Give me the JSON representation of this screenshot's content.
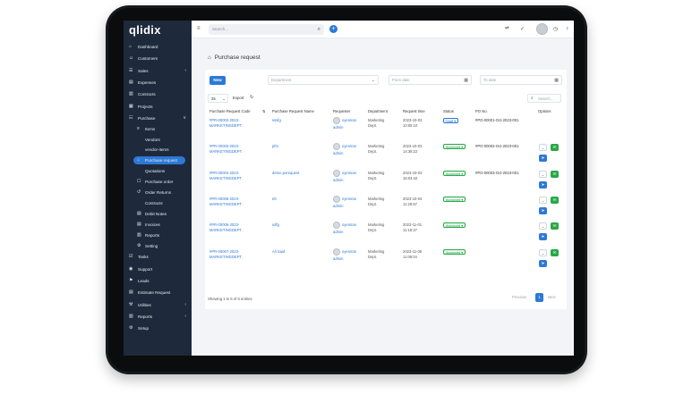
{
  "app": {
    "logo": "qlidix"
  },
  "sidebar": {
    "items": [
      {
        "label": "Dashboard",
        "icon": "⌂",
        "chev": ""
      },
      {
        "label": "Customers",
        "icon": "☺",
        "chev": ""
      },
      {
        "label": "Sales",
        "icon": "☰",
        "chev": "‹"
      },
      {
        "label": "Expenses",
        "icon": "▤",
        "chev": ""
      },
      {
        "label": "Contracts",
        "icon": "▥",
        "chev": ""
      },
      {
        "label": "Projects",
        "icon": "▦",
        "chev": ""
      },
      {
        "label": "Purchase",
        "icon": "☷",
        "chev": "∨"
      }
    ],
    "purchase_sub": [
      {
        "label": "Items",
        "icon": "≡"
      },
      {
        "label": "Vendors",
        "icon": ""
      },
      {
        "label": "vendor-items",
        "icon": ""
      },
      {
        "label": "Purchase request",
        "icon": "⌂"
      },
      {
        "label": "Quotations",
        "icon": ""
      },
      {
        "label": "Purchase order",
        "icon": "☐"
      },
      {
        "label": "Order Returns",
        "icon": "↺"
      },
      {
        "label": "Contracts",
        "icon": ""
      },
      {
        "label": "Debit Notes",
        "icon": "▤"
      },
      {
        "label": "Invoices",
        "icon": "▤"
      },
      {
        "label": "Reports",
        "icon": "▥"
      },
      {
        "label": "Setting",
        "icon": "⚙"
      }
    ],
    "bottom_items": [
      {
        "label": "Tasks",
        "icon": "☑",
        "chev": ""
      },
      {
        "label": "Support",
        "icon": "◉",
        "chev": ""
      },
      {
        "label": "Leads",
        "icon": "⚑",
        "chev": ""
      },
      {
        "label": "Estimate Request",
        "icon": "▤",
        "chev": ""
      },
      {
        "label": "Utilities",
        "icon": "⚒",
        "chev": "‹"
      },
      {
        "label": "Reports",
        "icon": "▥",
        "chev": "‹"
      },
      {
        "label": "Setup",
        "icon": "⚙",
        "chev": ""
      }
    ]
  },
  "topbar": {
    "search_placeholder": "Search...",
    "menu_icon": "≡",
    "search_icon": "⌕",
    "plus": "+",
    "share_icon": "⮂",
    "check_icon": "✓",
    "clock_icon": "◷",
    "bell_icon": "♪"
  },
  "page": {
    "title_icon": "⌂",
    "title": "Purchase request",
    "new_label": "New",
    "department_placeholder": "Department",
    "from_date_placeholder": "From date",
    "to_date_placeholder": "To date",
    "per_page": "25",
    "export_label": "Export",
    "refresh_icon": "↻",
    "search_placeholder": "Search...",
    "calendar_icon": "▦",
    "dropdown_icon": "⌄"
  },
  "table": {
    "headers": [
      "Purchase Request Code",
      "Purchase Request Name",
      "Requester",
      "Department",
      "Request time",
      "Status",
      "PO No.",
      "Options"
    ],
    "rows": [
      {
        "code1": "#PR-00002-2023-",
        "code2": "MARKETINGDEPT.",
        "name": "sssfg",
        "requester_name": "oyeniran",
        "requester_role": "admin",
        "dept1": "Marketing",
        "dept2": "Dept.",
        "time1": "2023-10-03",
        "time2": "10:05:10",
        "status": "Draft ▾",
        "status_type": "draft",
        "po": "#PO-00001-Oct-2023-001"
      },
      {
        "code1": "#PR-00003-2023-",
        "code2": "MARKETINGDEPT.",
        "name": "pfrx",
        "requester_name": "oyeniran",
        "requester_role": "admin",
        "dept1": "Marketing",
        "dept2": "Dept.",
        "time1": "2023-10-03",
        "time2": "14:38:22",
        "status": "Approved ▾",
        "status_type": "approved",
        "po": "#PO-00002-Oct-2023-001"
      },
      {
        "code1": "#PR-00004-2023-",
        "code2": "MARKETINGDEPT.",
        "name": "demo porequest",
        "requester_name": "oyeniran",
        "requester_role": "admin",
        "dept1": "Marketing",
        "dept2": "Dept.",
        "time1": "2023-10-03",
        "time2": "16:04:42",
        "status": "Approved ▾",
        "status_type": "approved",
        "po": "#PO-00003-Oct-2023-001"
      },
      {
        "code1": "#PR-00005-2023-",
        "code2": "MARKETINGDEPT.",
        "name": "ett",
        "requester_name": "oyeniran",
        "requester_role": "admin",
        "dept1": "Marketing",
        "dept2": "Dept.",
        "time1": "2023-10-04",
        "time2": "11:29:57",
        "status": "Approved ▾",
        "status_type": "approved",
        "po": ""
      },
      {
        "code1": "#PR-00006-2023-",
        "code2": "MARKETINGDEPT.",
        "name": "sdfg",
        "requester_name": "oyeniran",
        "requester_role": "admin",
        "dept1": "Marketing",
        "dept2": "Dept.",
        "time1": "2023-11-01",
        "time2": "11:18:27",
        "status": "Approved ▾",
        "status_type": "approved",
        "po": ""
      },
      {
        "code1": "#PR-00007-2023-",
        "code2": "MARKETINGDEPT.",
        "name": "Ali Said",
        "requester_name": "oyeniran",
        "requester_role": "admin",
        "dept1": "Marketing",
        "dept2": "Dept.",
        "time1": "2023-11-06",
        "time2": "11:06:04",
        "status": "Approved ▾",
        "status_type": "approved",
        "po": ""
      }
    ],
    "option_icons": {
      "chevron": "⌄",
      "chat": "✉",
      "share": "➤"
    },
    "sort_icon": "⇅"
  },
  "footer": {
    "showing": "Showing 1 to 6 of 6 entries",
    "previous": "Previous",
    "page": "1",
    "next": "Next"
  }
}
